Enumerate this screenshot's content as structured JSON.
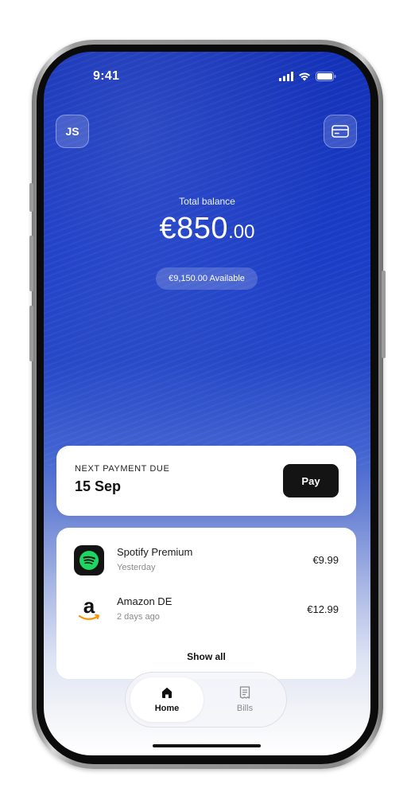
{
  "status_bar": {
    "time": "9:41"
  },
  "header": {
    "avatar_initials": "JS"
  },
  "balance": {
    "label": "Total balance",
    "amount_main": "€850",
    "amount_cents": ".00",
    "available": "€9,150.00 Available"
  },
  "next_payment": {
    "label": "NEXT PAYMENT DUE",
    "date": "15 Sep",
    "pay_label": "Pay"
  },
  "transactions": [
    {
      "name": "Spotify Premium",
      "date": "Yesterday",
      "amount": "€9.99",
      "icon": "spotify-logo"
    },
    {
      "name": "Amazon DE",
      "date": "2 days ago",
      "amount": "€12.99",
      "icon": "amazon-logo"
    }
  ],
  "show_all_label": "Show all",
  "tabs": [
    {
      "label": "Home",
      "icon": "home-icon",
      "active": true
    },
    {
      "label": "Bills",
      "icon": "receipt-icon",
      "active": false
    }
  ],
  "colors": {
    "accent_blue": "#1a3cc6",
    "pay_button": "#141414",
    "spotify_green": "#1ed760",
    "amazon_orange": "#f79400"
  }
}
